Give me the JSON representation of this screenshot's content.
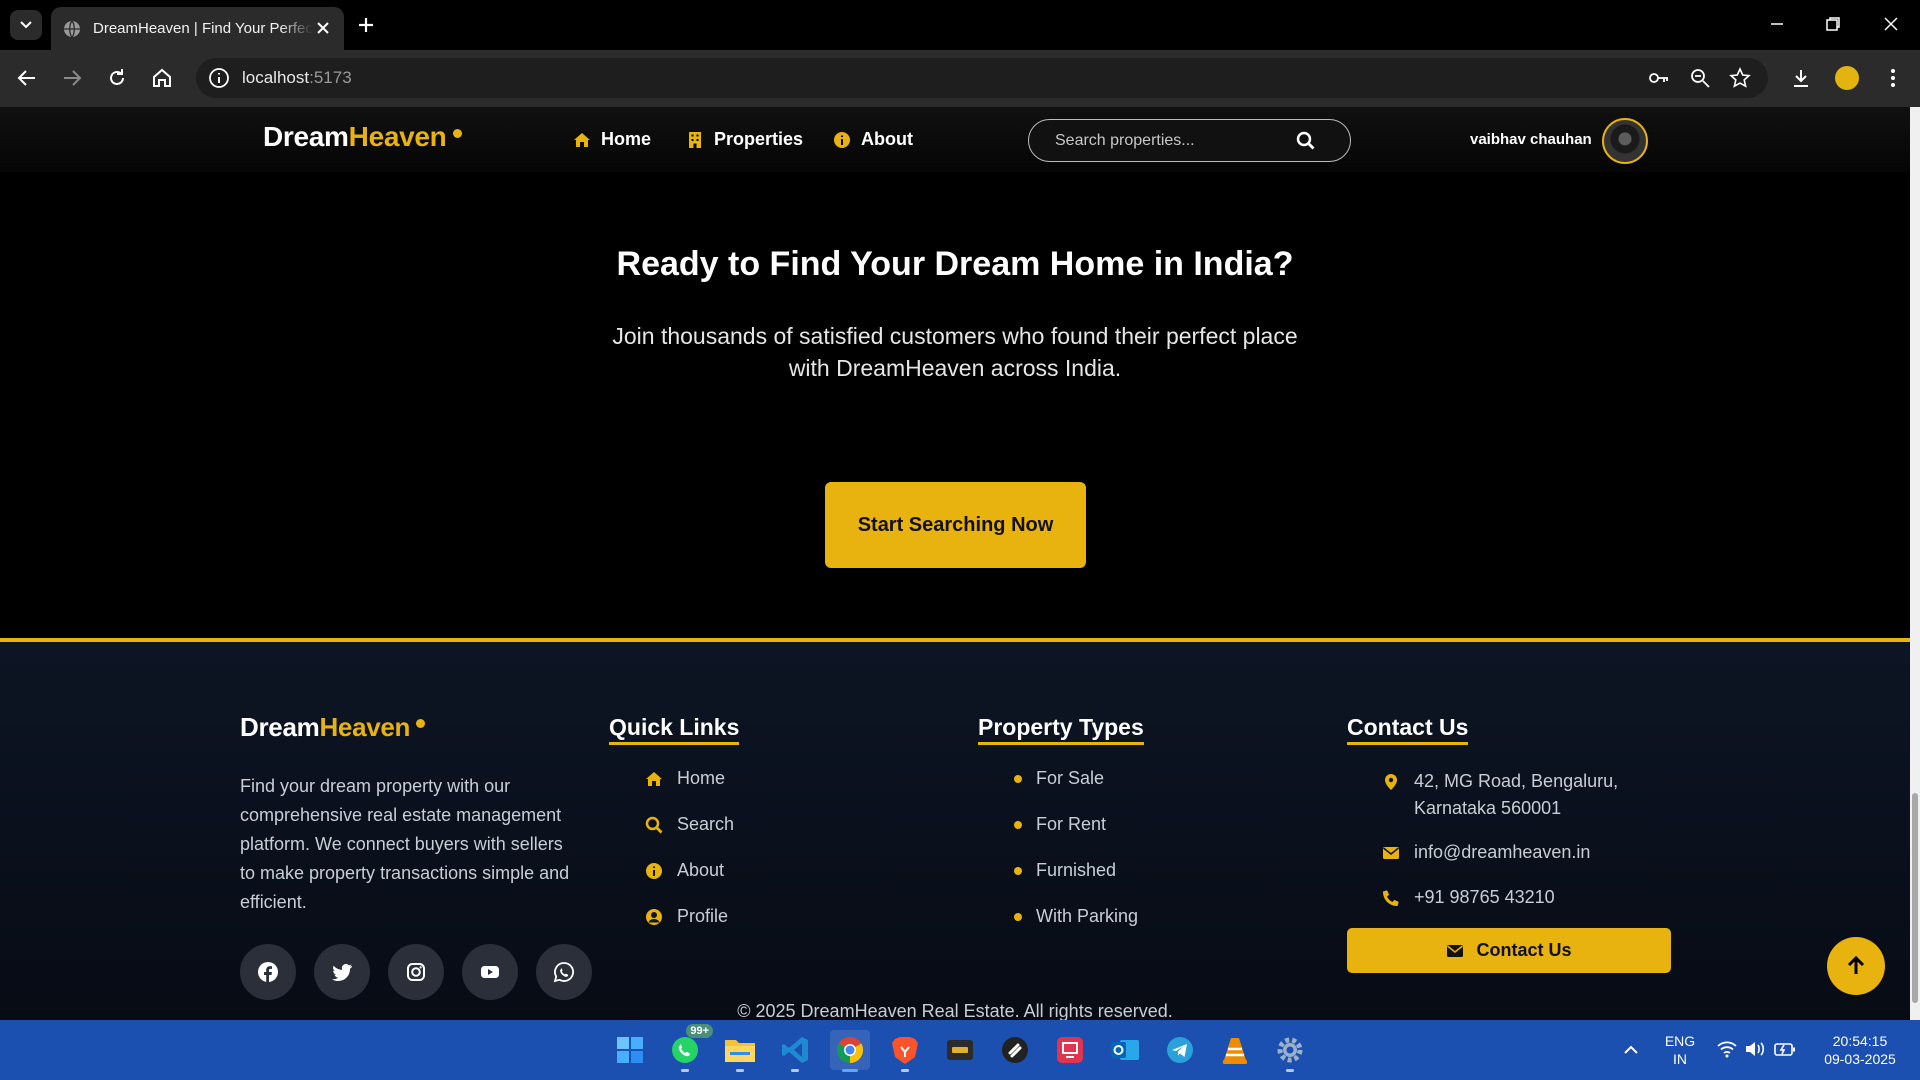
{
  "browser": {
    "tab_title": "DreamHeaven | Find Your Perfect Home",
    "url_host": "localhost",
    "url_port": ":5173",
    "profile_color": "#e3b40f"
  },
  "site": {
    "brand_main": "Dream",
    "brand_accent": "Heaven",
    "accent_color": "#e8b20f",
    "nav": [
      {
        "label": "Home",
        "icon": "home-icon"
      },
      {
        "label": "Properties",
        "icon": "building-icon"
      },
      {
        "label": "About",
        "icon": "info-icon"
      }
    ],
    "search_placeholder": "Search properties...",
    "username": "vaibhav chauhan"
  },
  "cta": {
    "title": "Ready to Find Your Dream Home in India?",
    "subtitle": "Join thousands of satisfied customers who found their perfect place with DreamHeaven across India.",
    "button": "Start Searching Now"
  },
  "footer": {
    "brand_main": "Dream",
    "brand_accent": "Heaven",
    "description": "Find your dream property with our comprehensive real estate management platform. We connect buyers with sellers to make property transactions simple and efficient.",
    "socials": [
      "facebook-icon",
      "twitter-icon",
      "instagram-icon",
      "youtube-icon",
      "whatsapp-icon"
    ],
    "quick_links": {
      "heading": "Quick Links",
      "items": [
        {
          "label": "Home",
          "icon": "home-icon"
        },
        {
          "label": "Search",
          "icon": "search-icon"
        },
        {
          "label": "About",
          "icon": "info-icon"
        },
        {
          "label": "Profile",
          "icon": "user-icon"
        }
      ]
    },
    "property_types": {
      "heading": "Property Types",
      "items": [
        "For Sale",
        "For Rent",
        "Furnished",
        "With Parking"
      ]
    },
    "contact": {
      "heading": "Contact Us",
      "address_line1": "42, MG Road, Bengaluru,",
      "address_line2": "Karnataka 560001",
      "email": "info@dreamheaven.in",
      "phone": "+91 98765 43210",
      "button": "Contact Us"
    },
    "copyright": "© 2025 DreamHeaven Real Estate. All rights reserved."
  },
  "taskbar": {
    "whatsapp_badge": "99+",
    "lang_top": "ENG",
    "lang_bottom": "IN",
    "time": "20:54:15",
    "date": "09-03-2025",
    "apps": [
      "windows-start-icon",
      "whatsapp-icon",
      "file-explorer-icon",
      "vscode-icon",
      "chrome-icon",
      "brave-icon",
      "terminal-icon",
      "app-icon",
      "app-icon",
      "outlook-icon",
      "telegram-icon",
      "vlc-icon",
      "settings-icon"
    ]
  }
}
